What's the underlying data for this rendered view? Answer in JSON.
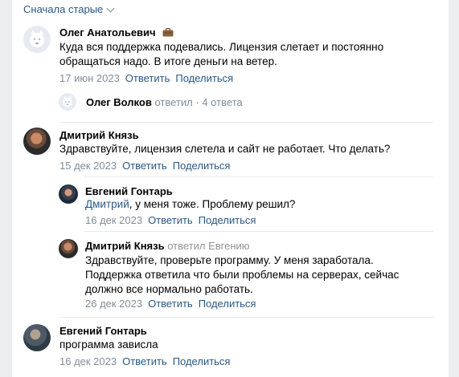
{
  "sort": {
    "label": "Сначала старые"
  },
  "comments": [
    {
      "author": "Олег Анатольевич",
      "text": "Куда вся поддержка подевались. Лицензия слетает и постоянно обращаться надо. В итоге деньги на ветер.",
      "date": "17 июн 2023",
      "reply": "Ответить",
      "share": "Поделиться",
      "replies_summary": {
        "author": "Олег Волков",
        "action": "ответил",
        "count": "4 ответа"
      }
    },
    {
      "author": "Дмитрий Князь",
      "text": "Здравствуйте, лицензия слетела и сайт не работает. Что делать?",
      "date": "15 дек 2023",
      "reply": "Ответить",
      "share": "Поделиться",
      "replies": [
        {
          "author": "Евгений Гонтарь",
          "mention": "Дмитрий",
          "text": ", у меня тоже. Проблему решил?",
          "date": "16 дек 2023",
          "reply": "Ответить",
          "share": "Поделиться"
        },
        {
          "author": "Дмитрий Князь",
          "reply_to": "ответил Евгению",
          "text": "Здравствуйте, проверьте программу. У меня заработала. Поддержка ответила что были проблемы на серверах, сейчас должно все нормально работать.",
          "date": "26 дек 2023",
          "reply": "Ответить",
          "share": "Поделиться"
        }
      ]
    },
    {
      "author": "Евгений Гонтарь",
      "text": "программа зависла",
      "date": "16 дек 2023",
      "reply": "Ответить",
      "share": "Поделиться"
    }
  ],
  "icons": {
    "briefcase": "briefcase-icon",
    "default_avatar": "dog-avatar-icon",
    "sort_chevron": "chevron-down-icon"
  }
}
